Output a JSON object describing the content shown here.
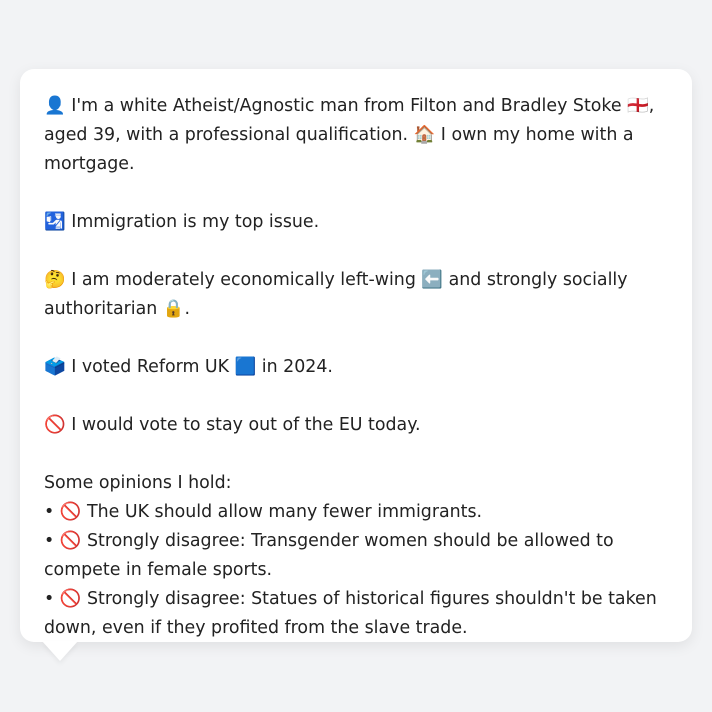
{
  "profile": {
    "p1_icon": "👤",
    "p1_text_a": "I'm a white Atheist/Agnostic man from Filton and Bradley Stoke",
    "p1_flag": "🏴󠁧󠁢󠁥󠁮󠁧󠁿",
    "p1_text_b": ", aged 39, with a professional qualification.",
    "p1_home_icon": "🏠",
    "p1_text_c": "I own my home with a mortgage.",
    "p2_icon": "🛂",
    "p2_text": "Immigration is my top issue.",
    "p3_icon": "🤔",
    "p3_text_a": "I am moderately economically left-wing",
    "p3_arrow_icon": "⬅️",
    "p3_text_b": "and strongly socially authoritarian",
    "p3_lock_icon": "🔒",
    "p3_text_c": ".",
    "p4_icon": "🗳️",
    "p4_text_a": "I voted Reform UK",
    "p4_square_icon": "🟦",
    "p4_text_b": "in 2024.",
    "p5_icon": "🚫",
    "p5_text": "I would vote to stay out of the EU today.",
    "opinions_heading": "Some opinions I hold:",
    "opinions": [
      {
        "bullet": "•",
        "icon": "🚫",
        "text": "The UK should allow many fewer immigrants."
      },
      {
        "bullet": "•",
        "icon": "🚫",
        "text": "Strongly disagree: Transgender women should be allowed to compete in female sports."
      },
      {
        "bullet": "•",
        "icon": "🚫",
        "text": "Strongly disagree: Statues of historical figures shouldn't be taken down, even if they profited from the slave trade."
      }
    ]
  }
}
